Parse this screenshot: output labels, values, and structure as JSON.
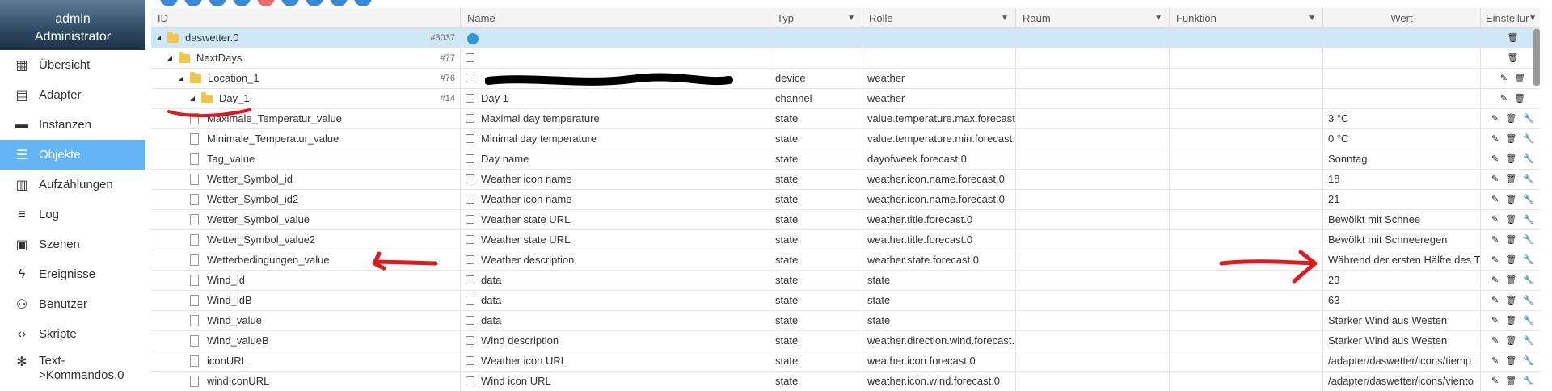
{
  "user": {
    "name": "admin",
    "role": "Administrator"
  },
  "nav": [
    {
      "icon": "grid-icon",
      "glyph": "▦",
      "label": "Übersicht",
      "active": false
    },
    {
      "icon": "store-icon",
      "glyph": "▤",
      "label": "Adapter",
      "active": false
    },
    {
      "icon": "instances-icon",
      "glyph": "▬",
      "label": "Instanzen",
      "active": false
    },
    {
      "icon": "list-icon",
      "glyph": "☰",
      "label": "Objekte",
      "active": true
    },
    {
      "icon": "enum-icon",
      "glyph": "▥",
      "label": "Aufzählungen",
      "active": false
    },
    {
      "icon": "log-icon",
      "glyph": "≡",
      "label": "Log",
      "active": false
    },
    {
      "icon": "scenes-icon",
      "glyph": "▣",
      "label": "Szenen",
      "active": false
    },
    {
      "icon": "bolt-icon",
      "glyph": "ϟ",
      "label": "Ereignisse",
      "active": false
    },
    {
      "icon": "user-icon",
      "glyph": "⚇",
      "label": "Benutzer",
      "active": false
    },
    {
      "icon": "code-icon",
      "glyph": "‹›",
      "label": "Skripte",
      "active": false
    },
    {
      "icon": "asterisk-icon",
      "glyph": "✻",
      "label": "Text->Kommandos.0",
      "active": false
    }
  ],
  "columns": {
    "id": "ID",
    "name": "Name",
    "typ": "Typ",
    "rolle": "Rolle",
    "raum": "Raum",
    "funktion": "Funktion",
    "wert": "Wert",
    "einstellungen": "Einstellur"
  },
  "rows": [
    {
      "level": 0,
      "kind": "folder",
      "id": "daswetter.0",
      "count": "#3037",
      "name": "",
      "nameIcon": "globe",
      "typ": "",
      "rolle": "",
      "wert": "",
      "acts": [
        "delete"
      ],
      "selected": true
    },
    {
      "level": 1,
      "kind": "folder",
      "id": "NextDays",
      "count": "#77",
      "name": "",
      "typ": "",
      "rolle": "",
      "wert": "",
      "acts": [
        "delete"
      ]
    },
    {
      "level": 2,
      "kind": "folder",
      "id": "Location_1",
      "count": "#76",
      "name": "",
      "nameIcon": "device",
      "typ": "device",
      "rolle": "weather",
      "wert": "",
      "acts": [
        "edit",
        "delete"
      ]
    },
    {
      "level": 3,
      "kind": "folder",
      "id": "Day_1",
      "count": "#14",
      "name": "Day 1",
      "nameIcon": "channel",
      "typ": "channel",
      "rolle": "weather",
      "wert": "",
      "acts": [
        "edit",
        "delete"
      ]
    },
    {
      "level": 4,
      "kind": "state",
      "id": "Maximale_Temperatur_value",
      "name": "Maximal day temperature",
      "typ": "state",
      "rolle": "value.temperature.max.forecast.",
      "wert": "3 °C",
      "acts": [
        "edit",
        "delete",
        "wrench"
      ]
    },
    {
      "level": 4,
      "kind": "state",
      "id": "Minimale_Temperatur_value",
      "name": "Minimal day temperature",
      "typ": "state",
      "rolle": "value.temperature.min.forecast.(",
      "wert": "0 °C",
      "acts": [
        "edit",
        "delete",
        "wrench"
      ]
    },
    {
      "level": 4,
      "kind": "state",
      "id": "Tag_value",
      "name": "Day name",
      "typ": "state",
      "rolle": "dayofweek.forecast.0",
      "wert": "Sonntag",
      "acts": [
        "edit",
        "delete",
        "wrench"
      ]
    },
    {
      "level": 4,
      "kind": "state",
      "id": "Wetter_Symbol_id",
      "name": "Weather icon name",
      "typ": "state",
      "rolle": "weather.icon.name.forecast.0",
      "wert": "18",
      "acts": [
        "edit",
        "delete",
        "wrench"
      ]
    },
    {
      "level": 4,
      "kind": "state",
      "id": "Wetter_Symbol_id2",
      "name": "Weather icon name",
      "typ": "state",
      "rolle": "weather.icon.name.forecast.0",
      "wert": "21",
      "acts": [
        "edit",
        "delete",
        "wrench"
      ]
    },
    {
      "level": 4,
      "kind": "state",
      "id": "Wetter_Symbol_value",
      "name": "Weather state URL",
      "typ": "state",
      "rolle": "weather.title.forecast.0",
      "wert": "Bewölkt mit Schnee",
      "acts": [
        "edit",
        "delete",
        "wrench"
      ]
    },
    {
      "level": 4,
      "kind": "state",
      "id": "Wetter_Symbol_value2",
      "name": "Weather state URL",
      "typ": "state",
      "rolle": "weather.title.forecast.0",
      "wert": "Bewölkt mit Schneeregen",
      "acts": [
        "edit",
        "delete",
        "wrench"
      ]
    },
    {
      "level": 4,
      "kind": "state",
      "id": "Wetterbedingungen_value",
      "name": "Weather description",
      "typ": "state",
      "rolle": "weather.state.forecast.0",
      "wert": "Während der ersten Hälfte des T",
      "acts": [
        "edit",
        "delete",
        "wrench"
      ]
    },
    {
      "level": 4,
      "kind": "state",
      "id": "Wind_id",
      "name": "data",
      "typ": "state",
      "rolle": "state",
      "wert": "23",
      "acts": [
        "edit",
        "delete",
        "wrench"
      ]
    },
    {
      "level": 4,
      "kind": "state",
      "id": "Wind_idB",
      "name": "data",
      "typ": "state",
      "rolle": "state",
      "wert": "63",
      "acts": [
        "edit",
        "delete",
        "wrench"
      ]
    },
    {
      "level": 4,
      "kind": "state",
      "id": "Wind_value",
      "name": "data",
      "typ": "state",
      "rolle": "state",
      "wert": "Starker Wind aus Westen",
      "acts": [
        "edit",
        "delete",
        "wrench"
      ]
    },
    {
      "level": 4,
      "kind": "state",
      "id": "Wind_valueB",
      "name": "Wind description",
      "typ": "state",
      "rolle": "weather.direction.wind.forecast.(",
      "wert": "Starker Wind aus Westen",
      "acts": [
        "edit",
        "delete",
        "wrench"
      ]
    },
    {
      "level": 4,
      "kind": "state",
      "id": "iconURL",
      "name": "Weather icon URL",
      "typ": "state",
      "rolle": "weather.icon.forecast.0",
      "wert": "/adapter/daswetter/icons/tiemp",
      "acts": [
        "edit",
        "delete",
        "wrench"
      ]
    },
    {
      "level": 4,
      "kind": "state",
      "id": "windIconURL",
      "name": "Wind icon URL",
      "typ": "state",
      "rolle": "weather.icon.wind.forecast.0",
      "wert": "/adapter/daswetter/icons/viento",
      "acts": [
        "edit",
        "delete",
        "wrench"
      ]
    }
  ],
  "colors": {
    "accent": "#64b5f6",
    "selected_row": "#cfe8f6",
    "annotation": "#e0191f"
  }
}
